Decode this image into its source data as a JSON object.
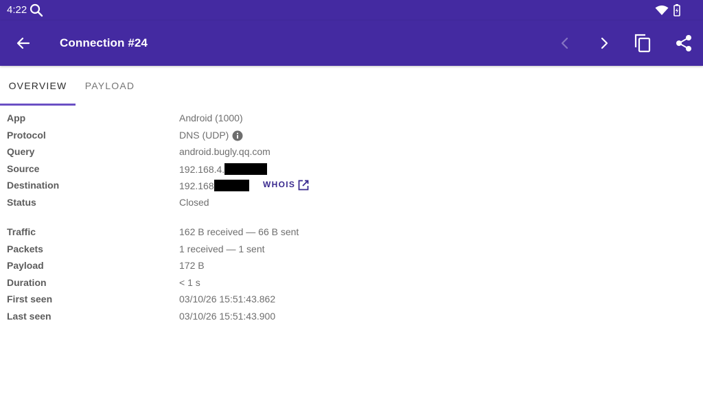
{
  "status_bar": {
    "time": "4:22",
    "icons": [
      "search-icon",
      "wifi-icon",
      "battery-charging-icon"
    ]
  },
  "app_bar": {
    "title": "Connection #24",
    "icons": [
      "arrow-back-icon",
      "chevron-left-icon",
      "chevron-right-icon",
      "copy-icon",
      "share-icon"
    ],
    "background_color": "#442aa1"
  },
  "tabs": [
    {
      "label": "Overview",
      "active": true
    },
    {
      "label": "Payload",
      "active": false
    }
  ],
  "accent_color": "#6a4fc4",
  "details": {
    "app": {
      "label": "App",
      "value": "Android (1000)"
    },
    "protocol": {
      "label": "Protocol",
      "value": "DNS (UDP)"
    },
    "query": {
      "label": "Query",
      "value": "android.bugly.qq.com"
    },
    "source": {
      "label": "Source",
      "value": "192.168.4."
    },
    "destination": {
      "label": "Destination",
      "value": "192.168",
      "action": "WHOIS"
    },
    "status": {
      "label": "Status",
      "value": "Closed"
    },
    "traffic": {
      "label": "Traffic",
      "value": "162 B received — 66 B sent"
    },
    "packets": {
      "label": "Packets",
      "value": "1 received — 1 sent"
    },
    "payload": {
      "label": "Payload",
      "value": "172 B"
    },
    "duration": {
      "label": "Duration",
      "value": "< 1 s"
    },
    "first_seen": {
      "label": "First seen",
      "value": "03/10/26 15:51:43.862"
    },
    "last_seen": {
      "label": "Last seen",
      "value": "03/10/26 15:51:43.900"
    }
  }
}
